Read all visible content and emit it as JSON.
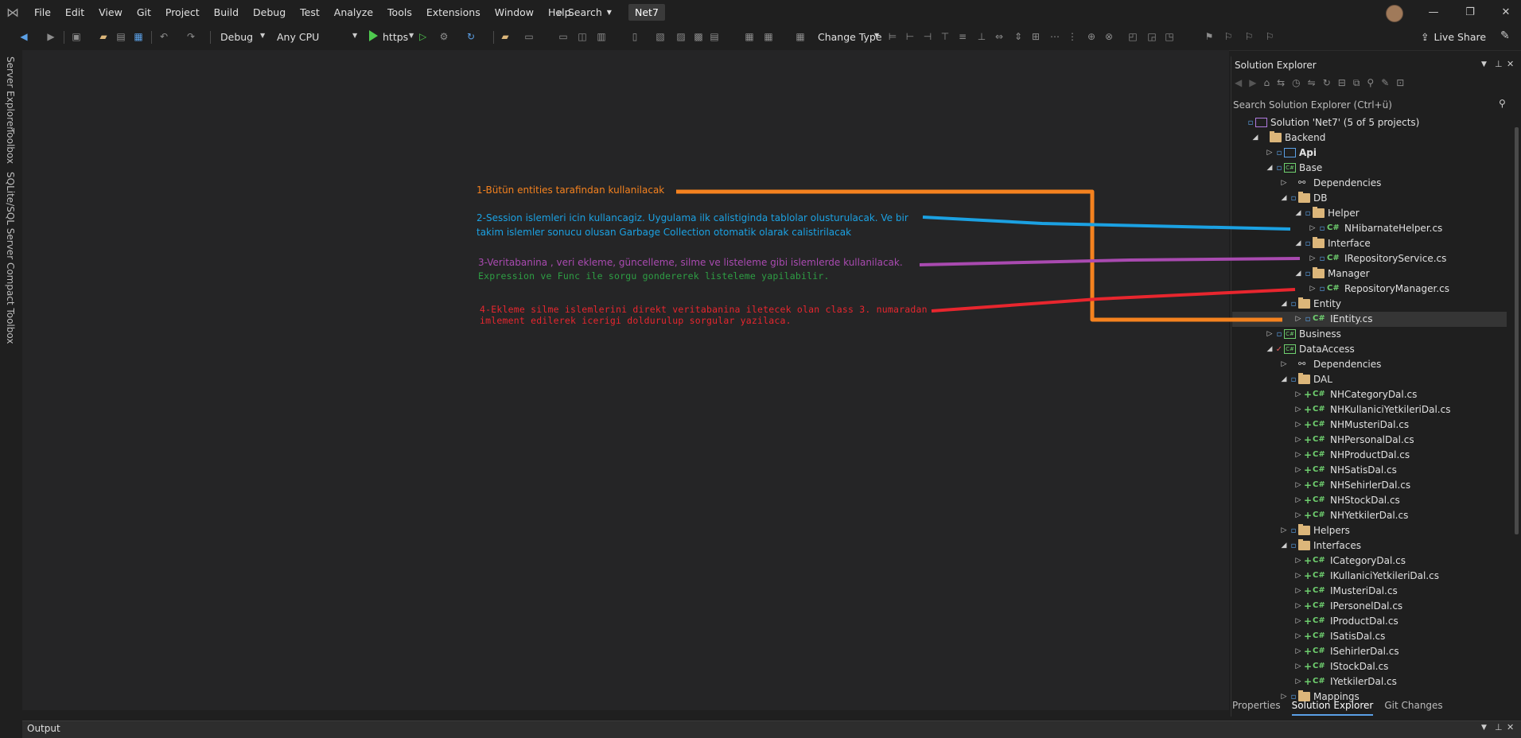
{
  "menu": {
    "items": [
      "File",
      "Edit",
      "View",
      "Git",
      "Project",
      "Build",
      "Debug",
      "Test",
      "Analyze",
      "Tools",
      "Extensions",
      "Window",
      "Help"
    ],
    "search_label": "Search",
    "project_name": "Net7"
  },
  "toolbar": {
    "config": "Debug",
    "platform": "Any CPU",
    "run_target": "https",
    "change_type": "Change Type",
    "live_share": "Live Share"
  },
  "left_tabs": [
    "Server Explorer",
    "Toolbox",
    "SQLite/SQL Server Compact Toolbox"
  ],
  "annotations": {
    "a1": "1-Bütün entities tarafindan kullanilacak",
    "a2_line1": "2-Session islemleri icin kullancagiz. Uygulama ilk calistiginda tablolar olusturulacak. Ve bir",
    "a2_line2": "takim islemler sonucu olusan Garbage Collection otomatik olarak calistirilacak",
    "a3_line1": "3-Veritabanina , veri ekleme, güncelleme, silme ve listeleme gibi islemlerde kullanilacak.",
    "a3_line2": "Expression ve Func ile sorgu gondererek listeleme yapilabilir.",
    "a4_line1": "4-Ekleme silme islemlerini direkt veritabanina iletecek olan class 3. numaradan",
    "a4_line2": "imlement edilerek icerigi doldurulup sorgular yazilaca.",
    "colors": {
      "orange": "#f5821f",
      "blue": "#1ba1e2",
      "purple": "#a94ab0",
      "green": "#2e9e44",
      "red": "#e8262e"
    }
  },
  "solution_explorer": {
    "title": "Solution Explorer",
    "search_placeholder": "Search Solution Explorer (Ctrl+ü)",
    "tabs": [
      "Properties",
      "Solution Explorer",
      "Git Changes"
    ],
    "tree": [
      {
        "label": "Solution 'Net7' (5 of 5 projects)",
        "depth": 0,
        "icon": "sln",
        "expander": "none",
        "lock": true
      },
      {
        "label": "Backend",
        "depth": 1,
        "icon": "folder",
        "expander": "open",
        "lock": false
      },
      {
        "label": "Api",
        "depth": 2,
        "icon": "web",
        "expander": "closed",
        "lock": true,
        "bold": true
      },
      {
        "label": "Base",
        "depth": 2,
        "icon": "csproj",
        "expander": "open",
        "lock": true
      },
      {
        "label": "Dependencies",
        "depth": 3,
        "icon": "deps",
        "expander": "closed",
        "lock": false
      },
      {
        "label": "DB",
        "depth": 3,
        "icon": "folder",
        "expander": "open",
        "lock": true
      },
      {
        "label": "Helper",
        "depth": 4,
        "icon": "folder",
        "expander": "open",
        "lock": true
      },
      {
        "label": "NHibarnateHelper.cs",
        "depth": 5,
        "icon": "cs",
        "expander": "closed",
        "lock": true
      },
      {
        "label": "Interface",
        "depth": 4,
        "icon": "folder",
        "expander": "open",
        "lock": true
      },
      {
        "label": "IRepositoryService.cs",
        "depth": 5,
        "icon": "cs",
        "expander": "closed",
        "lock": true
      },
      {
        "label": "Manager",
        "depth": 4,
        "icon": "folder",
        "expander": "open",
        "lock": true
      },
      {
        "label": "RepositoryManager.cs",
        "depth": 5,
        "icon": "cs",
        "expander": "closed",
        "lock": true
      },
      {
        "label": "Entity",
        "depth": 3,
        "icon": "folder",
        "expander": "open",
        "lock": true
      },
      {
        "label": "IEntity.cs",
        "depth": 4,
        "icon": "cs",
        "expander": "closed",
        "lock": true,
        "selected": true
      },
      {
        "label": "Business",
        "depth": 2,
        "icon": "csproj",
        "expander": "closed",
        "lock": true
      },
      {
        "label": "DataAccess",
        "depth": 2,
        "icon": "csproj",
        "expander": "open",
        "check": true
      },
      {
        "label": "Dependencies",
        "depth": 3,
        "icon": "deps",
        "expander": "closed",
        "lock": false
      },
      {
        "label": "DAL",
        "depth": 3,
        "icon": "folder",
        "expander": "open",
        "lock": true
      },
      {
        "label": "NHCategoryDal.cs",
        "depth": 4,
        "icon": "cs",
        "expander": "closed",
        "plus": true
      },
      {
        "label": "NHKullaniciYetkileriDal.cs",
        "depth": 4,
        "icon": "cs",
        "expander": "closed",
        "plus": true
      },
      {
        "label": "NHMusteriDal.cs",
        "depth": 4,
        "icon": "cs",
        "expander": "closed",
        "plus": true
      },
      {
        "label": "NHPersonalDal.cs",
        "depth": 4,
        "icon": "cs",
        "expander": "closed",
        "plus": true
      },
      {
        "label": "NHProductDal.cs",
        "depth": 4,
        "icon": "cs",
        "expander": "closed",
        "plus": true
      },
      {
        "label": "NHSatisDal.cs",
        "depth": 4,
        "icon": "cs",
        "expander": "closed",
        "plus": true
      },
      {
        "label": "NHSehirlerDal.cs",
        "depth": 4,
        "icon": "cs",
        "expander": "closed",
        "plus": true
      },
      {
        "label": "NHStockDal.cs",
        "depth": 4,
        "icon": "cs",
        "expander": "closed",
        "plus": true
      },
      {
        "label": "NHYetkilerDal.cs",
        "depth": 4,
        "icon": "cs",
        "expander": "closed",
        "plus": true
      },
      {
        "label": "Helpers",
        "depth": 3,
        "icon": "folder",
        "expander": "closed",
        "lock": true
      },
      {
        "label": "Interfaces",
        "depth": 3,
        "icon": "folder",
        "expander": "open",
        "lock": true
      },
      {
        "label": "ICategoryDal.cs",
        "depth": 4,
        "icon": "cs",
        "expander": "closed",
        "plus": true
      },
      {
        "label": "IKullaniciYetkileriDal.cs",
        "depth": 4,
        "icon": "cs",
        "expander": "closed",
        "plus": true
      },
      {
        "label": "IMusteriDal.cs",
        "depth": 4,
        "icon": "cs",
        "expander": "closed",
        "plus": true
      },
      {
        "label": "IPersonelDal.cs",
        "depth": 4,
        "icon": "cs",
        "expander": "closed",
        "plus": true
      },
      {
        "label": "IProductDal.cs",
        "depth": 4,
        "icon": "cs",
        "expander": "closed",
        "plus": true
      },
      {
        "label": "ISatisDal.cs",
        "depth": 4,
        "icon": "cs",
        "expander": "closed",
        "plus": true
      },
      {
        "label": "ISehirlerDal.cs",
        "depth": 4,
        "icon": "cs",
        "expander": "closed",
        "plus": true
      },
      {
        "label": "IStockDal.cs",
        "depth": 4,
        "icon": "cs",
        "expander": "closed",
        "plus": true
      },
      {
        "label": "IYetkilerDal.cs",
        "depth": 4,
        "icon": "cs",
        "expander": "closed",
        "plus": true
      },
      {
        "label": "Mappings",
        "depth": 3,
        "icon": "folder",
        "expander": "closed",
        "lock": true
      }
    ]
  },
  "output": {
    "title": "Output"
  }
}
